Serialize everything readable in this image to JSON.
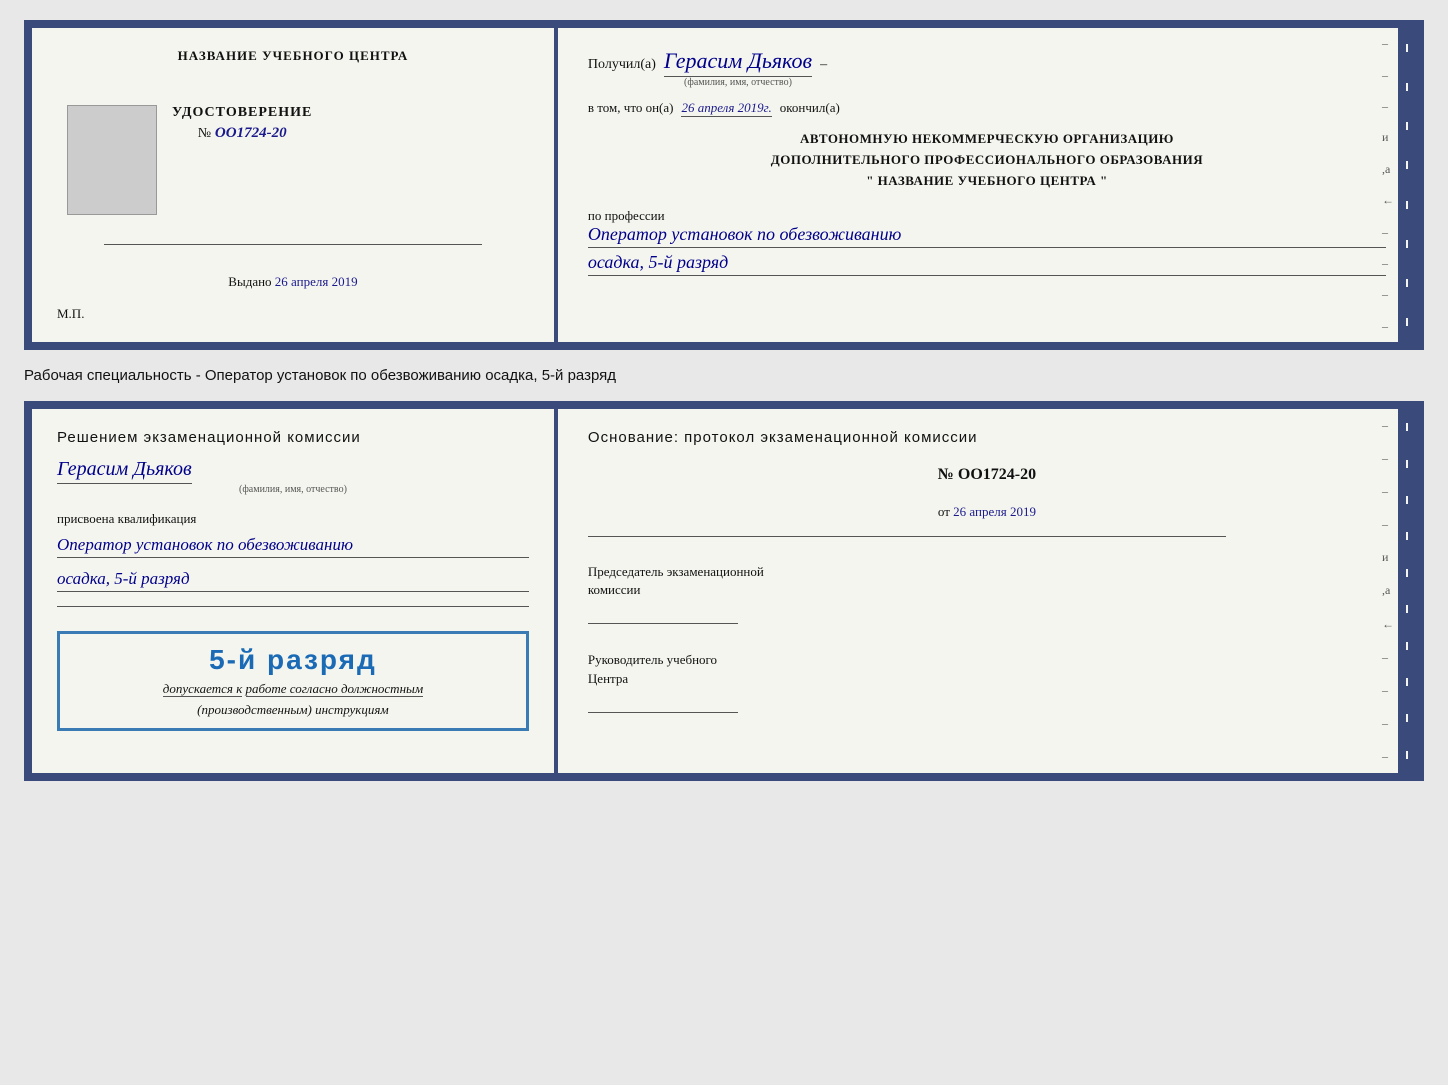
{
  "top_card": {
    "left": {
      "school_name": "НАЗВАНИЕ УЧЕБНОГО ЦЕНТРА",
      "cert_title": "УДОСТОВЕРЕНИЕ",
      "cert_number_prefix": "№",
      "cert_number": "OO1724-20",
      "issued_label": "Выдано",
      "issued_date": "26 апреля 2019",
      "mp_label": "М.П."
    },
    "right": {
      "received_label": "Получил(а)",
      "recipient_name": "Герасим Дьяков",
      "name_sublabel": "(фамилия, имя, отчество)",
      "dash": "–",
      "confirm_label": "в том, что он(а)",
      "confirm_date": "26 апреля 2019г.",
      "confirm_end": "окончил(а)",
      "org_line1": "АВТОНОМНУЮ НЕКОММЕРЧЕСКУЮ ОРГАНИЗАЦИЮ",
      "org_line2": "ДОПОЛНИТЕЛЬНОГО ПРОФЕССИОНАЛЬНОГО ОБРАЗОВАНИЯ",
      "org_line3": "\"  НАЗВАНИЕ УЧЕБНОГО ЦЕНТРА  \"",
      "profession_label": "по профессии",
      "profession_value": "Оператор установок по обезвоживанию",
      "rank_value": "осадка, 5-й разряд"
    }
  },
  "specialty_label": "Рабочая специальность - Оператор установок по обезвоживанию осадка, 5-й разряд",
  "bottom_card": {
    "left": {
      "decision_title": "Решением экзаменационной комиссии",
      "name": "Герасим Дьяков",
      "name_sublabel": "(фамилия, имя, отчество)",
      "qual_label": "присвоена квалификация",
      "qual_value": "Оператор установок по обезвоживанию",
      "qual_rank": "осадка, 5-й разряд",
      "stamp_rank": "5-й разряд",
      "allowed_text": "допускается к",
      "allowed_underline": "работе согласно должностным",
      "allowed_end": "(производственным) инструкциям"
    },
    "right": {
      "basis_title": "Основание: протокол экзаменационной комиссии",
      "protocol_number": "№  OO1724-20",
      "from_label": "от",
      "from_date": "26 апреля 2019",
      "chairman_title": "Председатель экзаменационной",
      "chairman_title2": "комиссии",
      "director_title": "Руководитель учебного",
      "director_title2": "Центра"
    }
  }
}
